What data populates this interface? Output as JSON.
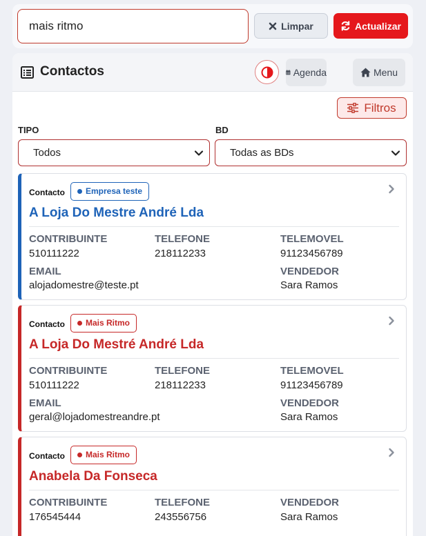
{
  "search": {
    "value": "mais ritmo"
  },
  "toolbar": {
    "clear_label": "Limpar",
    "update_label": "Actualizar"
  },
  "header": {
    "title": "Contactos",
    "agenda_label": "Agenda",
    "menu_label": "Menu",
    "filters_label": "Filtros"
  },
  "filters": {
    "tipo_label": "TIPO",
    "tipo_value": "Todos",
    "bd_label": "BD",
    "bd_value": "Todas as BDs"
  },
  "colors": {
    "accent_red": "#e5181c",
    "empresa_blue": "#1e63b8",
    "mais_ritmo_red": "#c62828"
  },
  "cards": [
    {
      "type": "Contacto",
      "badge": "Empresa teste",
      "name": "A Loja Do Mestre André Lda",
      "contribuinte_label": "CONTRIBUINTE",
      "contribuinte": "510111222",
      "telefone_label": "TELEFONE",
      "telefone": "218112233",
      "telemovel_label": "TELEMOVEL",
      "telemovel": "91123456789",
      "email_label": "EMAIL",
      "email": "alojadomestre@teste.pt",
      "vendedor_label": "VENDEDOR",
      "vendedor": "Sara Ramos"
    },
    {
      "type": "Contacto",
      "badge": "Mais Ritmo",
      "name": "A Loja Do Mestré André Lda",
      "contribuinte_label": "CONTRIBUINTE",
      "contribuinte": "510111222",
      "telefone_label": "TELEFONE",
      "telefone": "218112233",
      "telemovel_label": "TELEMOVEL",
      "telemovel": "91123456789",
      "email_label": "EMAIL",
      "email": "geral@lojadomestreandre.pt",
      "vendedor_label": "VENDEDOR",
      "vendedor": "Sara Ramos"
    },
    {
      "type": "Contacto",
      "badge": "Mais Ritmo",
      "name": "Anabela Da Fonseca",
      "contribuinte_label": "CONTRIBUINTE",
      "contribuinte": "176545444",
      "telefone_label": "TELEFONE",
      "telefone": "243556756",
      "vendedor_label": "VENDEDOR",
      "vendedor": "Sara Ramos"
    }
  ]
}
